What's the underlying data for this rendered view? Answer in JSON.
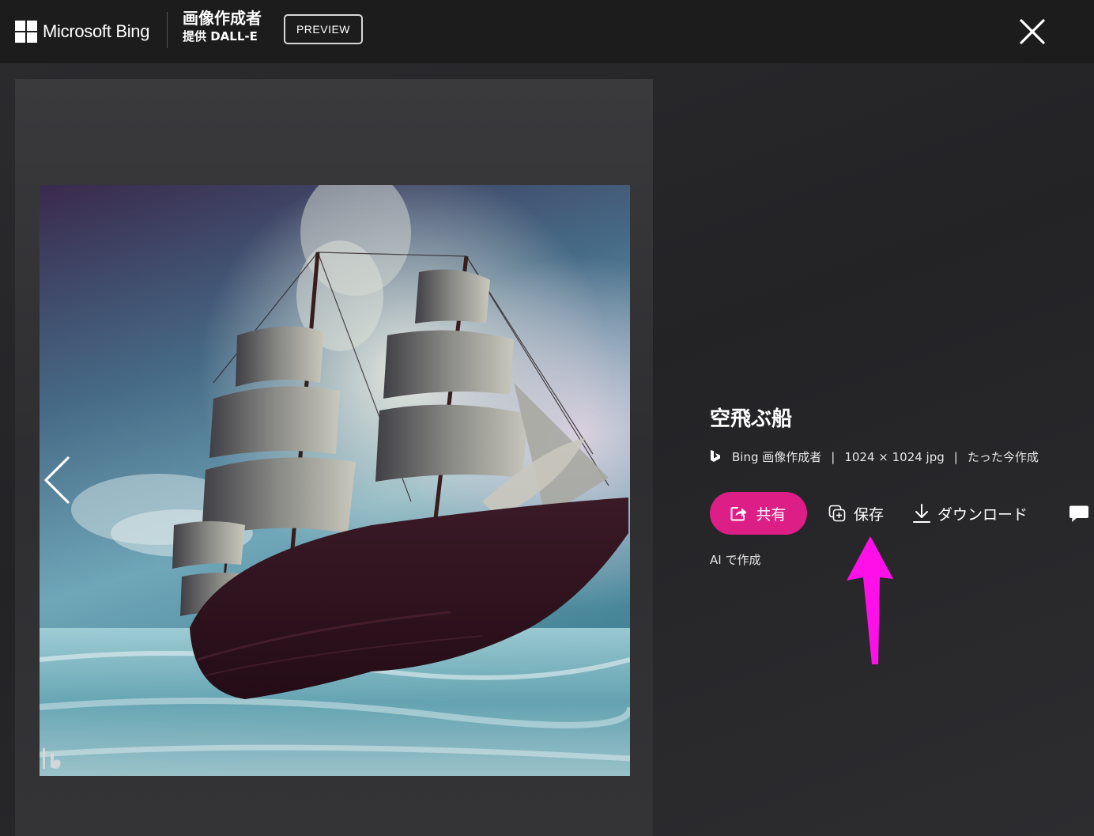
{
  "header": {
    "brand": "Microsoft Bing",
    "app_title": "画像作成者",
    "provided_by": "提供 DALL-E",
    "badge": "PREVIEW"
  },
  "image": {
    "alt": "空飛ぶ船"
  },
  "details": {
    "title": "空飛ぶ船",
    "source": "Bing 画像作成者",
    "separator": "|",
    "dimensions": "1024 × 1024 jpg",
    "created": "たった今作成",
    "made_with_ai": "AI で作成"
  },
  "actions": {
    "share_label": "共有",
    "save_label": "保存",
    "download_label": "ダウンロード"
  },
  "icons": {
    "close": "close-icon",
    "prev": "chevron-left-icon",
    "share": "share-icon",
    "save": "save-collection-icon",
    "download": "download-icon",
    "feedback": "feedback-icon",
    "bing": "bing-logo-icon"
  },
  "colors": {
    "accent": "#dd1e87",
    "annotation": "#ff10e8",
    "background": "#1c1c1c"
  }
}
